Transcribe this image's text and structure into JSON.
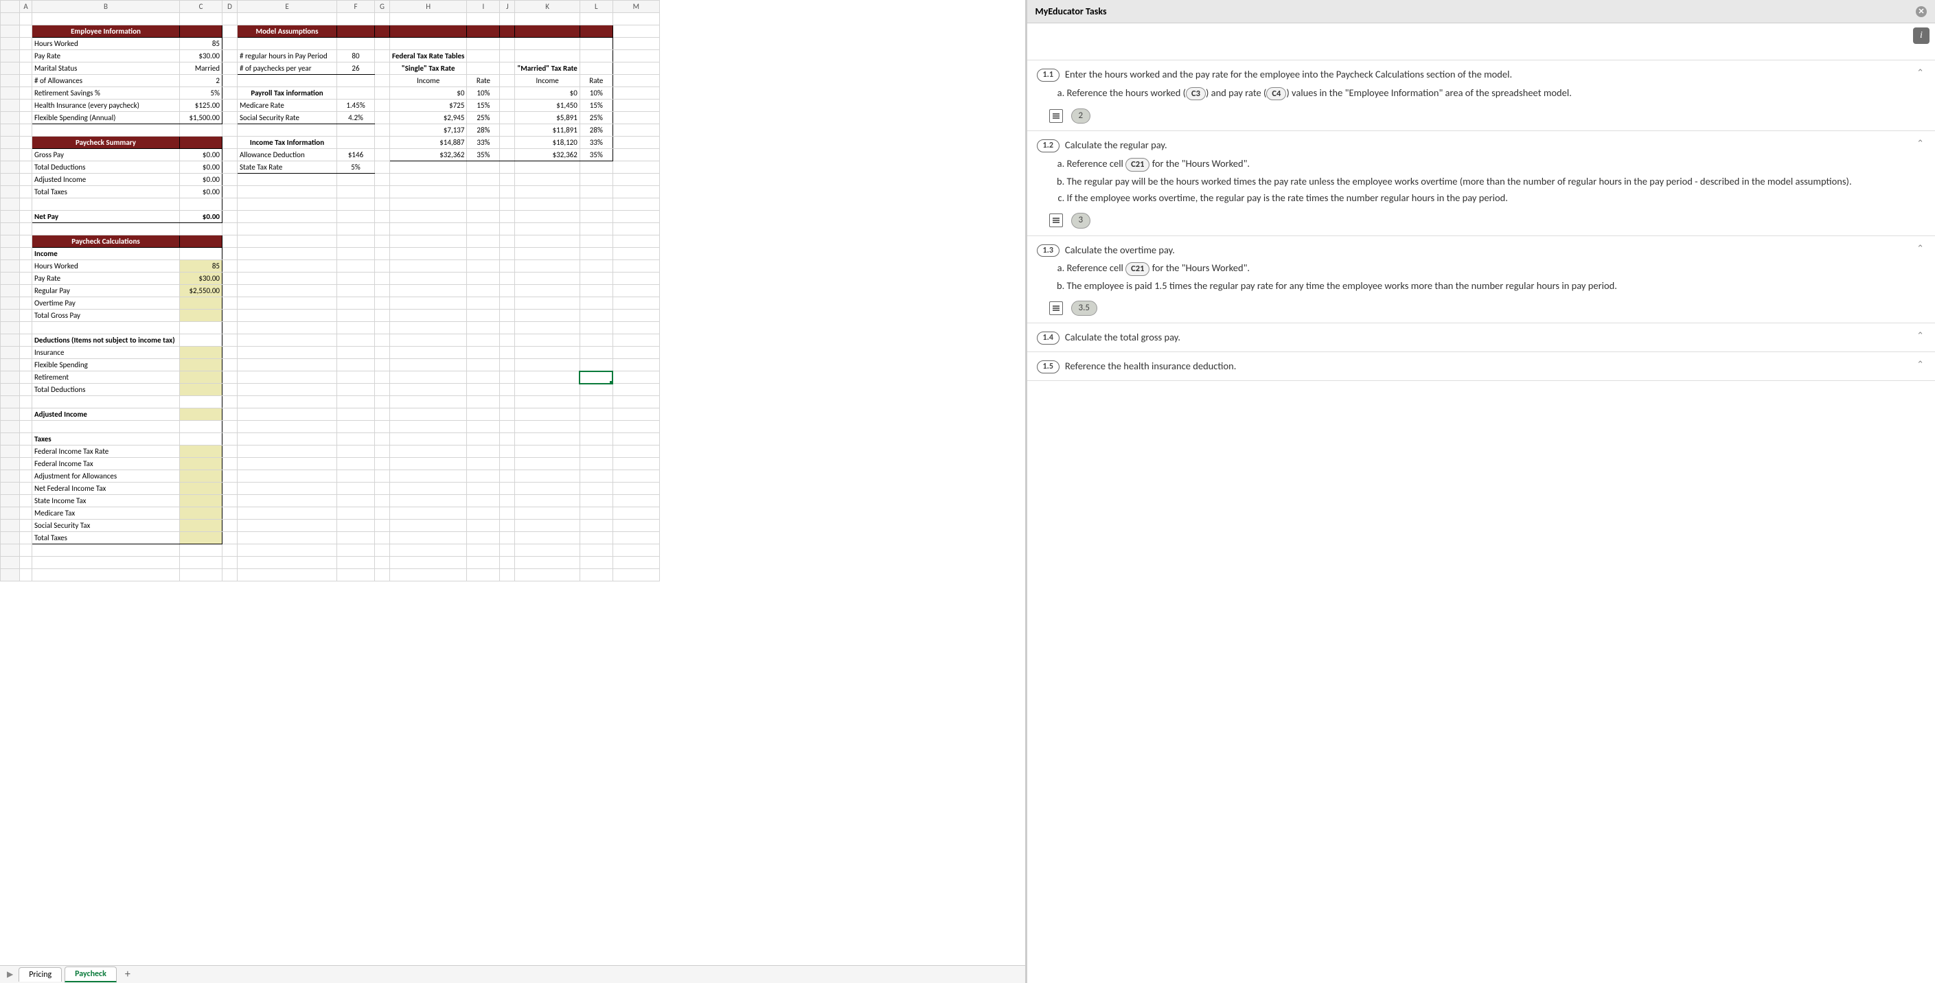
{
  "columns": [
    "A",
    "B",
    "C",
    "D",
    "E",
    "F",
    "G",
    "H",
    "I",
    "J",
    "K",
    "L",
    "M"
  ],
  "sections": {
    "employee_info_header": "Employee Information",
    "model_assumptions_header": "Model Assumptions",
    "paycheck_summary_header": "Paycheck Summary",
    "paycheck_calculations_header": "Paycheck Calculations"
  },
  "employee_info": {
    "hours_worked_label": "Hours Worked",
    "hours_worked_val": "85",
    "pay_rate_label": "Pay Rate",
    "pay_rate_val": "$30.00",
    "marital_label": "Marital Status",
    "marital_val": "Married",
    "allowances_label": "# of Allowances",
    "allowances_val": "2",
    "retirement_label": "Retirement Savings %",
    "retirement_val": "5%",
    "health_label": "Health Insurance (every paycheck)",
    "health_val": "$125.00",
    "flex_label": "Flexible Spending (Annual)",
    "flex_val": "$1,500.00"
  },
  "assumptions": {
    "reg_hours_label": "# regular hours in Pay Period",
    "reg_hours_val": "80",
    "paychecks_label": "# of paychecks per year",
    "paychecks_val": "26",
    "payroll_tax_header": "Payroll Tax information",
    "medicare_label": "Medicare Rate",
    "medicare_val": "1.45%",
    "ss_label": "Social Security Rate",
    "ss_val": "4.2%",
    "income_tax_header": "Income Tax Information",
    "allowance_ded_label": "Allowance Deduction",
    "allowance_ded_val": "$146",
    "state_tax_label": "State Tax Rate",
    "state_tax_val": "5%",
    "fed_tables_header": "Federal Tax Rate Tables",
    "single_header": "\"Single\" Tax Rate",
    "married_header": "\"Married\" Tax Rate",
    "income_label": "Income",
    "rate_label": "Rate",
    "single_rows": [
      {
        "inc": "$0",
        "rate": "10%"
      },
      {
        "inc": "$725",
        "rate": "15%"
      },
      {
        "inc": "$2,945",
        "rate": "25%"
      },
      {
        "inc": "$7,137",
        "rate": "28%"
      },
      {
        "inc": "$14,887",
        "rate": "33%"
      },
      {
        "inc": "$32,362",
        "rate": "35%"
      }
    ],
    "married_rows": [
      {
        "inc": "$0",
        "rate": "10%"
      },
      {
        "inc": "$1,450",
        "rate": "15%"
      },
      {
        "inc": "$5,891",
        "rate": "25%"
      },
      {
        "inc": "$11,891",
        "rate": "28%"
      },
      {
        "inc": "$18,120",
        "rate": "33%"
      },
      {
        "inc": "$32,362",
        "rate": "35%"
      }
    ]
  },
  "summary": {
    "gross_label": "Gross Pay",
    "gross_val": "$0.00",
    "total_ded_label": "Total Deductions",
    "total_ded_val": "$0.00",
    "adj_income_label": "Adjusted Income",
    "adj_income_val": "$0.00",
    "total_taxes_label": "Total Taxes",
    "total_taxes_val": "$0.00",
    "net_pay_label": "Net Pay",
    "net_pay_val": "$0.00"
  },
  "calc": {
    "income_label": "Income",
    "hours_worked_label": "Hours Worked",
    "hours_worked_val": "85",
    "pay_rate_label": "Pay Rate",
    "pay_rate_val": "$30.00",
    "regular_pay_label": "Regular Pay",
    "regular_pay_val": "$2,550.00",
    "overtime_label": "Overtime Pay",
    "gross_label": "Total Gross Pay",
    "deductions_header": "Deductions (Items not subject to income tax)",
    "insurance_label": "Insurance",
    "flex_label": "Flexible Spending",
    "retirement_label": "Retirement",
    "total_ded_label": "Total Deductions",
    "adj_income_label": "Adjusted Income",
    "taxes_label": "Taxes",
    "fed_rate_label": "Federal Income Tax Rate",
    "fed_tax_label": "Federal Income Tax",
    "adj_allow_label": "Adjustment for Allowances",
    "net_fed_label": "Net Federal Income Tax",
    "state_tax_label": "State Income Tax",
    "medicare_label": "Medicare Tax",
    "ss_label": "Social Security Tax",
    "total_taxes_label": "Total Taxes"
  },
  "tabs": {
    "pricing": "Pricing",
    "paycheck": "Paycheck"
  },
  "taskpane": {
    "title": "MyEducator Tasks",
    "tasks": [
      {
        "num": "1.1",
        "title": "Enter the hours worked and the pay rate for the employee into the Paycheck Calculations section of the model.",
        "subs": [
          {
            "pre": "Reference the hours worked (",
            "ref": "C3",
            "mid": ") and pay rate (",
            "ref2": "C4",
            "post": ") values in the \"Employee Information\" area of the spreadsheet model."
          }
        ],
        "points": "2"
      },
      {
        "num": "1.2",
        "title": "Calculate the regular pay.",
        "subs": [
          {
            "pre": "Reference cell ",
            "ref": "C21",
            "post": " for the \"Hours Worked\"."
          },
          {
            "text": "The regular pay will be the hours worked times the pay rate unless the employee works overtime (more than the number of regular hours in the pay period - described in the model assumptions)."
          },
          {
            "text": "If the employee works overtime, the regular pay is the rate times the number regular hours in the pay period."
          }
        ],
        "points": "3"
      },
      {
        "num": "1.3",
        "title": "Calculate the overtime pay.",
        "subs": [
          {
            "pre": "Reference cell ",
            "ref": "C21",
            "post": " for the \"Hours Worked\"."
          },
          {
            "text": "The employee is paid 1.5 times the regular pay rate for any time the employee works more than the number regular hours in pay period."
          }
        ],
        "points": "3.5"
      },
      {
        "num": "1.4",
        "title": "Calculate the total gross pay.",
        "collapsed": true
      },
      {
        "num": "1.5",
        "title": "Reference the health insurance deduction.",
        "collapsed": true
      }
    ]
  }
}
